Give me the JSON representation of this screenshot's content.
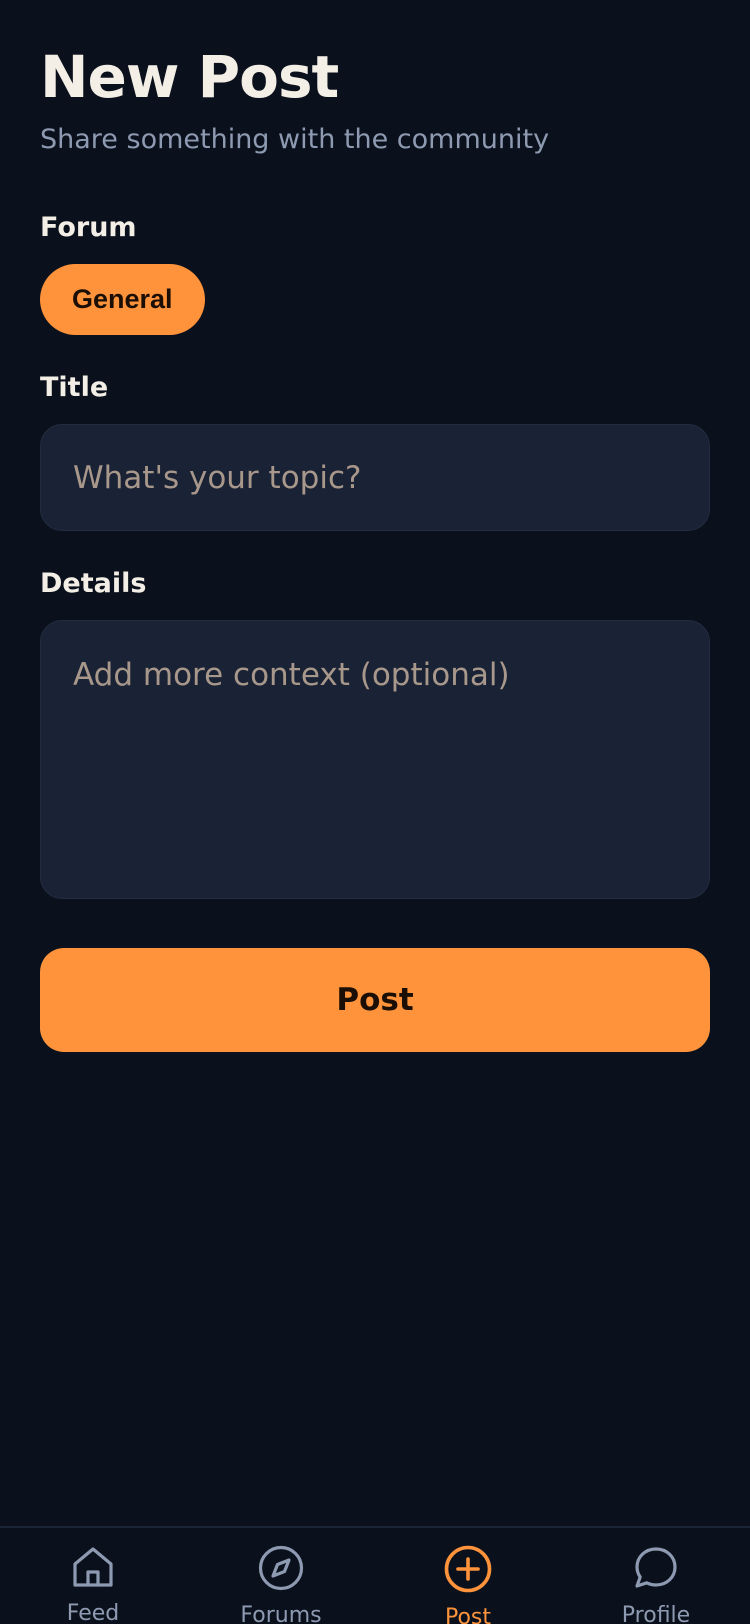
{
  "header": {
    "title": "New Post",
    "subtitle": "Share something with the community"
  },
  "form": {
    "forum_label": "Forum",
    "forum_selected": "General",
    "title_label": "Title",
    "title_placeholder": "What's your topic?",
    "details_label": "Details",
    "details_placeholder": "Add more context (optional)",
    "submit_label": "Post"
  },
  "nav": {
    "items": [
      {
        "label": "Feed",
        "icon": "home-icon",
        "active": false
      },
      {
        "label": "Forums",
        "icon": "compass-icon",
        "active": false
      },
      {
        "label": "Post",
        "icon": "plus-circle-icon",
        "active": true
      },
      {
        "label": "Profile",
        "icon": "chat-bubble-icon",
        "active": false
      }
    ]
  },
  "colors": {
    "background": "#0b111c",
    "accent": "#fe933b",
    "input_bg": "#1a2235",
    "muted_text": "#8d9ab1",
    "primary_text": "#f4efe6"
  }
}
